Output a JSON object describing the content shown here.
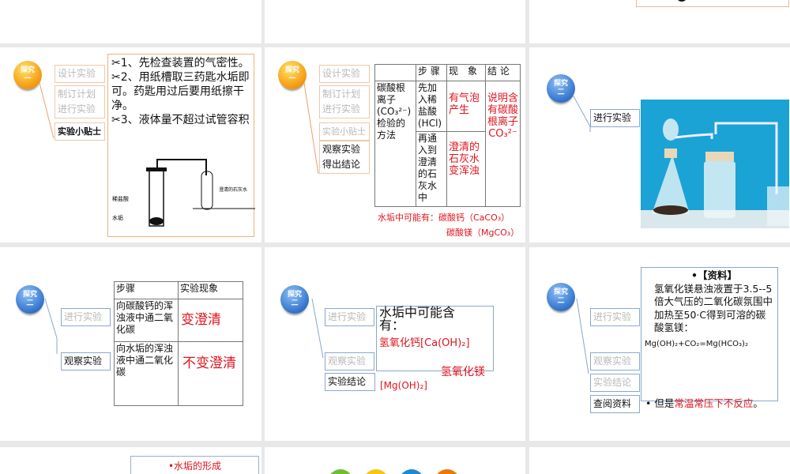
{
  "badges": {
    "one": "探究\n一",
    "two": "探究\n二",
    "line1": "探究",
    "one_num": "一",
    "two_num": "二"
  },
  "nav": {
    "design": "设计实验",
    "plan": "制订计划",
    "conduct": "进行实验",
    "tips": "实验小贴士",
    "observe": "观察实验",
    "conclude_line": "得出结论",
    "conclusion": "实验结论",
    "research": "查阅资料"
  },
  "slide_tips": {
    "tip1": "✂1、先检查装置的气密性。",
    "tip2": "✂2、用纸槽取三药匙水垢即可。药匙用过后要用纸擦干净。",
    "tip3": "✂3、液体量不超过试管容积",
    "diagram_labels": [
      "稀盐酸",
      "水垢",
      "澄清的石灰水"
    ]
  },
  "slide_carbonate": {
    "headers": [
      "",
      "步 骤",
      "现　象",
      "结 论"
    ],
    "method": "碳酸根离子(CO₃²⁻)检验的方法",
    "step1": "先加入稀盐酸(HCl)",
    "obs1": "有气泡产生",
    "step2": "再通入到澄清的石灰水中",
    "obs2": "澄清的石灰水变浑浊",
    "conclusion": "说明含有碳酸根离子CO₃²⁻",
    "note_line1": "水垢中可能有：碳酸钙（CaCO₃）",
    "note_line2": "碳酸镁（MgCO₃）"
  },
  "slide_observe": {
    "headers": [
      "步骤",
      "实验现象"
    ],
    "rows": [
      [
        "向碳酸钙的浑浊液中通二氧化碳",
        "变澄清"
      ],
      [
        "向水垢的浑浊液中通二氧化碳",
        "不变澄清"
      ]
    ]
  },
  "slide_conclusion": {
    "title": "水垢中可能含有：",
    "item1": "氢氧化钙[Ca(OH)₂]",
    "item2": "氢氧化镁",
    "item2b": "[Mg(OH)₂]"
  },
  "slide_research": {
    "title": "•【资料】",
    "body": "氢氧化镁悬浊液置于3.5--5倍大气压的二氧化碳氛围中加热至50·C得到可溶的碳酸氢镁：",
    "equation": "Mg(OH)₂+CO₂=Mg(HCO₃)₂",
    "but": "但是",
    "but_red": "常温常压下不反应",
    "end": "。"
  },
  "slide_bottom": {
    "title": "•水垢的形成"
  },
  "colors": {
    "accent_red": "#e0141e",
    "orange_border": "#f0b07a",
    "blue_border": "#8aa8cc"
  }
}
